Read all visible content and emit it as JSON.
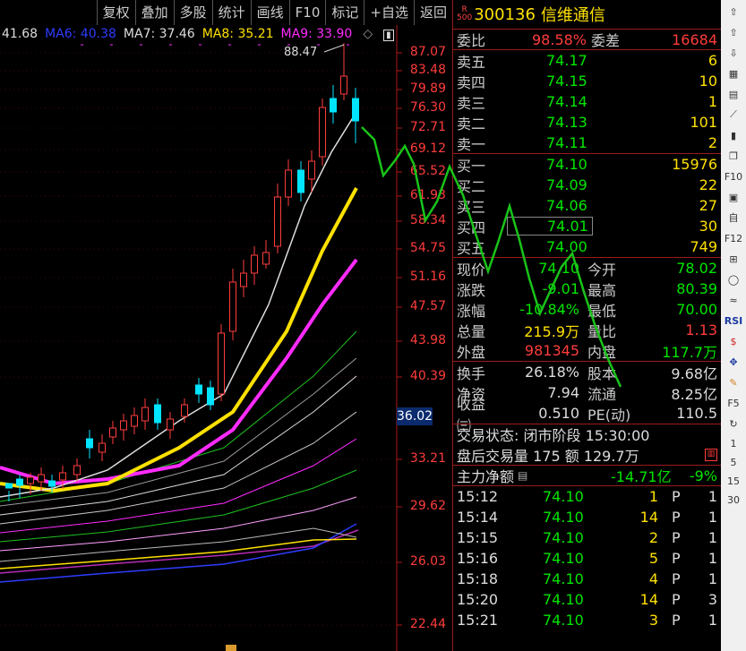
{
  "toolbar": {
    "items": [
      "复权",
      "叠加",
      "多股",
      "统计",
      "画线",
      "F10",
      "标记",
      "+自选",
      "返回"
    ]
  },
  "ma_legend": [
    {
      "label": "41.68",
      "color": "#dddddd"
    },
    {
      "label": "MA6: 40.38",
      "color": "#2d3cff"
    },
    {
      "label": "MA7: 37.46",
      "color": "#dddddd"
    },
    {
      "label": "MA8: 35.21",
      "color": "#ffe100"
    },
    {
      "label": "MA9: 33.90",
      "color": "#ff2bff"
    }
  ],
  "price_axis": [
    "87.07",
    "83.48",
    "79.89",
    "76.30",
    "72.71",
    "69.12",
    "65.52",
    "61.93",
    "58.34",
    "54.75",
    "51.16",
    "47.57",
    "43.98",
    "40.39",
    "36.02",
    "33.21",
    "29.62",
    "26.03",
    "22.44"
  ],
  "current_price_label": "36.02",
  "high_label": "88.47",
  "stock": {
    "badge_top": "R",
    "badge_bottom": "500",
    "code": "300136",
    "name": "信维通信"
  },
  "weibi": {
    "label": "委比",
    "value": "98.58%",
    "label2": "委差",
    "value2": "16684"
  },
  "asks": [
    {
      "label": "卖五",
      "price": "74.17",
      "vol": "6"
    },
    {
      "label": "卖四",
      "price": "74.15",
      "vol": "10"
    },
    {
      "label": "卖三",
      "price": "74.14",
      "vol": "1"
    },
    {
      "label": "卖二",
      "price": "74.13",
      "vol": "101"
    },
    {
      "label": "卖一",
      "price": "74.11",
      "vol": "2"
    }
  ],
  "bids": [
    {
      "label": "买一",
      "price": "74.10",
      "vol": "15976"
    },
    {
      "label": "买二",
      "price": "74.09",
      "vol": "22"
    },
    {
      "label": "买三",
      "price": "74.06",
      "vol": "27"
    },
    {
      "label": "买四",
      "price": "74.01",
      "vol": "30"
    },
    {
      "label": "买五",
      "price": "74.00",
      "vol": "749"
    }
  ],
  "stats": [
    {
      "l1": "现价",
      "v1": "74.10",
      "l2": "今开",
      "v2": "78.02",
      "c1": "c-green",
      "c2": "c-green"
    },
    {
      "l1": "涨跌",
      "v1": "-9.01",
      "l2": "最高",
      "v2": "80.39",
      "c1": "c-green",
      "c2": "c-green"
    },
    {
      "l1": "涨幅",
      "v1": "-10.84%",
      "l2": "最低",
      "v2": "70.00",
      "c1": "c-green",
      "c2": "c-green"
    },
    {
      "l1": "总量",
      "v1": "215.9万",
      "l2": "量比",
      "v2": "1.13",
      "c1": "c-yellow",
      "c2": "c-red"
    },
    {
      "l1": "外盘",
      "v1": "981345",
      "l2": "内盘",
      "v2": "117.7万",
      "c1": "c-red",
      "c2": "c-green"
    }
  ],
  "stats2": [
    {
      "l1": "换手",
      "v1": "26.18%",
      "l2": "股本",
      "v2": "9.68亿"
    },
    {
      "l1": "净资",
      "v1": "7.94",
      "l2": "流通",
      "v2": "8.25亿"
    },
    {
      "l1": "收益㈢",
      "v1": "0.510",
      "l2": "PE(动)",
      "v2": "110.5"
    }
  ],
  "trade_status": "交易状态: 闭市阶段 15:30:00",
  "after_hours": "盘后交易量 175 额 129.7万",
  "main_flow": {
    "label": "主力净额",
    "value": "-14.71亿",
    "pct": "-9%"
  },
  "ticks": [
    {
      "time": "15:12",
      "price": "74.10",
      "vol": "1",
      "flag": "P",
      "n": "1"
    },
    {
      "time": "15:14",
      "price": "74.10",
      "vol": "14",
      "flag": "P",
      "n": "1"
    },
    {
      "time": "15:15",
      "price": "74.10",
      "vol": "2",
      "flag": "P",
      "n": "1"
    },
    {
      "time": "15:16",
      "price": "74.10",
      "vol": "5",
      "flag": "P",
      "n": "1"
    },
    {
      "time": "15:18",
      "price": "74.10",
      "vol": "4",
      "flag": "P",
      "n": "1"
    },
    {
      "time": "15:20",
      "price": "74.10",
      "vol": "14",
      "flag": "P",
      "n": "3"
    },
    {
      "time": "15:21",
      "price": "74.10",
      "vol": "3",
      "flag": "P",
      "n": "1"
    }
  ],
  "sidebar": {
    "icons": [
      "up-arrow-icon",
      "up-outline-icon",
      "down-outline-icon",
      "calendar-icon",
      "chart-bar-icon",
      "line-chart-icon",
      "candle-icon",
      "copy-icon",
      "f10-icon",
      "f-tile-icon",
      "zi-icon",
      "f12-icon",
      "zoom-icon",
      "circle-icon",
      "wave-icon",
      "rsi-icon",
      "dollar-icon",
      "move-icon",
      "pen-icon",
      "f5-icon",
      "refresh-icon"
    ],
    "numbers": [
      "1",
      "5",
      "15",
      "30"
    ],
    "rsi_label": "RSI"
  }
}
